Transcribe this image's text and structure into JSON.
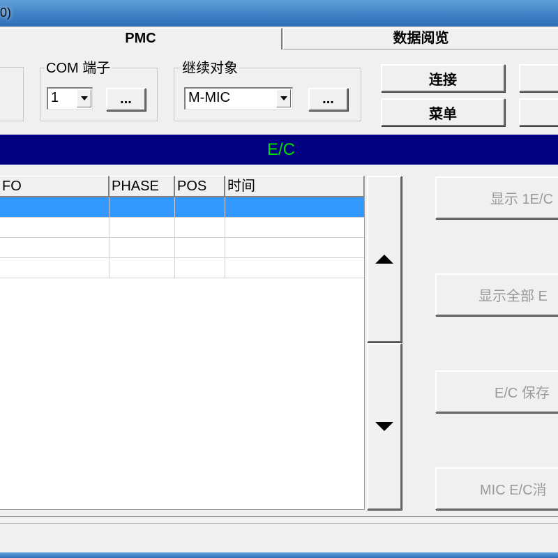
{
  "window": {
    "title_fragment": "0)"
  },
  "tabs": [
    {
      "label": "PMC"
    },
    {
      "label": "数据阅览"
    }
  ],
  "com_group": {
    "label": "COM 端子",
    "port_value": "1",
    "browse_label": "..."
  },
  "target_group": {
    "label": "继续对象",
    "target_value": "M-MIC",
    "browse_label": "..."
  },
  "actions": {
    "connect_label": "连接",
    "menu_label": "菜单"
  },
  "banner": {
    "text": "E/C"
  },
  "grid": {
    "columns": [
      "FO",
      "PHASE",
      "POS",
      "时间"
    ],
    "rows": [
      [
        "",
        "",
        "",
        ""
      ],
      [
        "",
        "",
        "",
        ""
      ],
      [
        "",
        "",
        "",
        ""
      ],
      [
        "",
        "",
        "",
        ""
      ]
    ],
    "selected_row": 0
  },
  "side_buttons": {
    "show_one_label": "显示 1E/C",
    "show_all_label": "显示全部 E",
    "save_label": "E/C 保存",
    "clear_label": "MIC E/C消"
  },
  "icons": {
    "scroll_up": "triangle-up-icon",
    "scroll_down": "triangle-down-icon",
    "combo_arrow": "chevron-down-icon"
  },
  "colors": {
    "banner_bg": "#000080",
    "banner_text": "#00e000",
    "selection": "#3399ff",
    "disabled_text": "#9a9a9a"
  }
}
